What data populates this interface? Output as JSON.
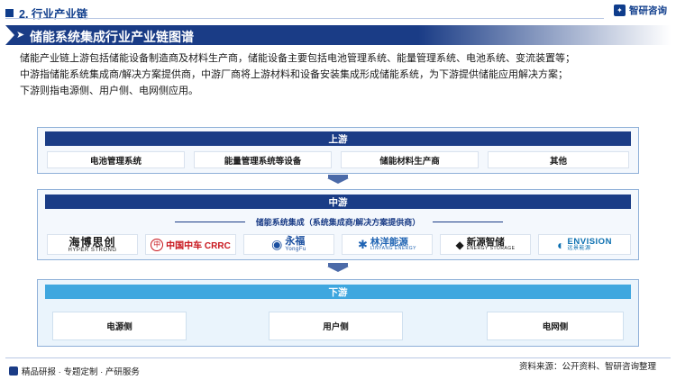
{
  "header": {
    "section_title": "2. 行业产业链",
    "brand_name": "智研咨询"
  },
  "title_bar": {
    "title": "储能系统集成行业产业链图谱"
  },
  "intro": [
    "储能产业链上游包括储能设备制造商及材料生产商，储能设备主要包括电池管理系统、能量管理系统、电池系统、变流装置等；",
    "中游指储能系统集成商/解决方案提供商，中游厂商将上游材料和设备安装集成形成储能系统，为下游提供储能应用解决方案；",
    "下游则指电源侧、用户侧、电网侧应用。"
  ],
  "upstream": {
    "label": "上游",
    "items": [
      "电池管理系统",
      "能量管理系统等设备",
      "储能材料生产商",
      "其他"
    ]
  },
  "midstream": {
    "label": "中游",
    "subtitle": "储能系统集成（系统集成商/解决方案提供商）",
    "companies": [
      {
        "name": "海博思创",
        "sub": "HYPER STRONG",
        "icon": "",
        "color": "#1a1a1a"
      },
      {
        "name": "中国中车 CRRC",
        "sub": "",
        "icon": "中",
        "color": "#c8161d"
      },
      {
        "name": "永福",
        "sub": "YongFu",
        "icon": "◉",
        "color": "#1a4fa0"
      },
      {
        "name": "林洋能源",
        "sub": "LINYANG ENERGY",
        "icon": "✱",
        "color": "#1e63b3"
      },
      {
        "name": "新源智储",
        "sub": "ENERGY STORAGE",
        "icon": "◆",
        "color": "#1a1a1a"
      },
      {
        "name": "ENVISION",
        "sub": "远景能源",
        "icon": "◐",
        "color": "#0b6fb0"
      }
    ]
  },
  "downstream": {
    "label": "下游",
    "items": [
      "电源侧",
      "用户侧",
      "电网侧"
    ]
  },
  "footer": {
    "left": "精品研报 · 专题定制 · 产研服务",
    "source": "资料来源：公开资料、智研咨询整理"
  }
}
